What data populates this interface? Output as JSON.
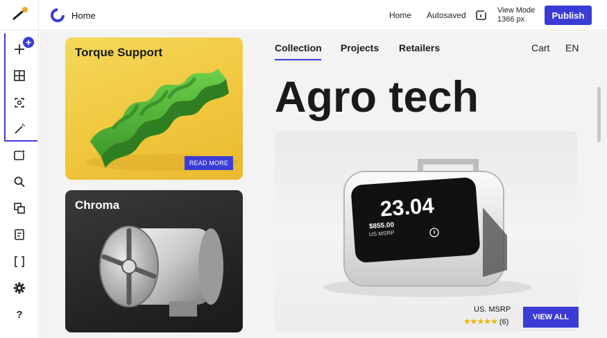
{
  "editor": {
    "page_name": "Home",
    "nav_home": "Home",
    "autosave_status": "Autosaved",
    "view_mode_label": "View Mode",
    "view_mode_value": "1366 px",
    "publish_label": "Publish"
  },
  "sidebar": {
    "items": [
      {
        "icon": "add-icon",
        "glyph": "+"
      },
      {
        "icon": "grid-icon",
        "glyph": "⊞"
      },
      {
        "icon": "media-icon",
        "glyph": "⧉"
      },
      {
        "icon": "magic-wand-icon",
        "glyph": "⚡"
      },
      {
        "icon": "frame-icon",
        "glyph": "◰"
      },
      {
        "icon": "search-icon",
        "glyph": "⌕"
      },
      {
        "icon": "layers-icon",
        "glyph": "⧈"
      },
      {
        "icon": "page-icon",
        "glyph": "▤"
      },
      {
        "icon": "code-brackets-icon",
        "glyph": "[ ]"
      },
      {
        "icon": "gear-icon",
        "glyph": "⚙"
      },
      {
        "icon": "help-icon",
        "glyph": "?"
      }
    ],
    "badge": "+"
  },
  "site": {
    "nav": {
      "collection": "Collection",
      "projects": "Projects",
      "retailers": "Retailers",
      "cart": "Cart",
      "language": "EN"
    },
    "hero_title": "Agro tech",
    "cards": [
      {
        "title": "Torque Support",
        "button": "READ MORE"
      },
      {
        "title": "Chroma"
      }
    ],
    "product": {
      "display_value": "23.04",
      "display_price": "$855.00",
      "display_subtitle": "US MSRP",
      "msrp_label": "US. MSRP",
      "rating_stars": "★★★★★",
      "rating_count": "(6)",
      "cta": "VIEW ALL"
    }
  },
  "colors": {
    "accent": "#3b3bd6",
    "yellow_card": "#f0c63c",
    "green_object": "#4caf3a",
    "star": "#f0b400"
  }
}
